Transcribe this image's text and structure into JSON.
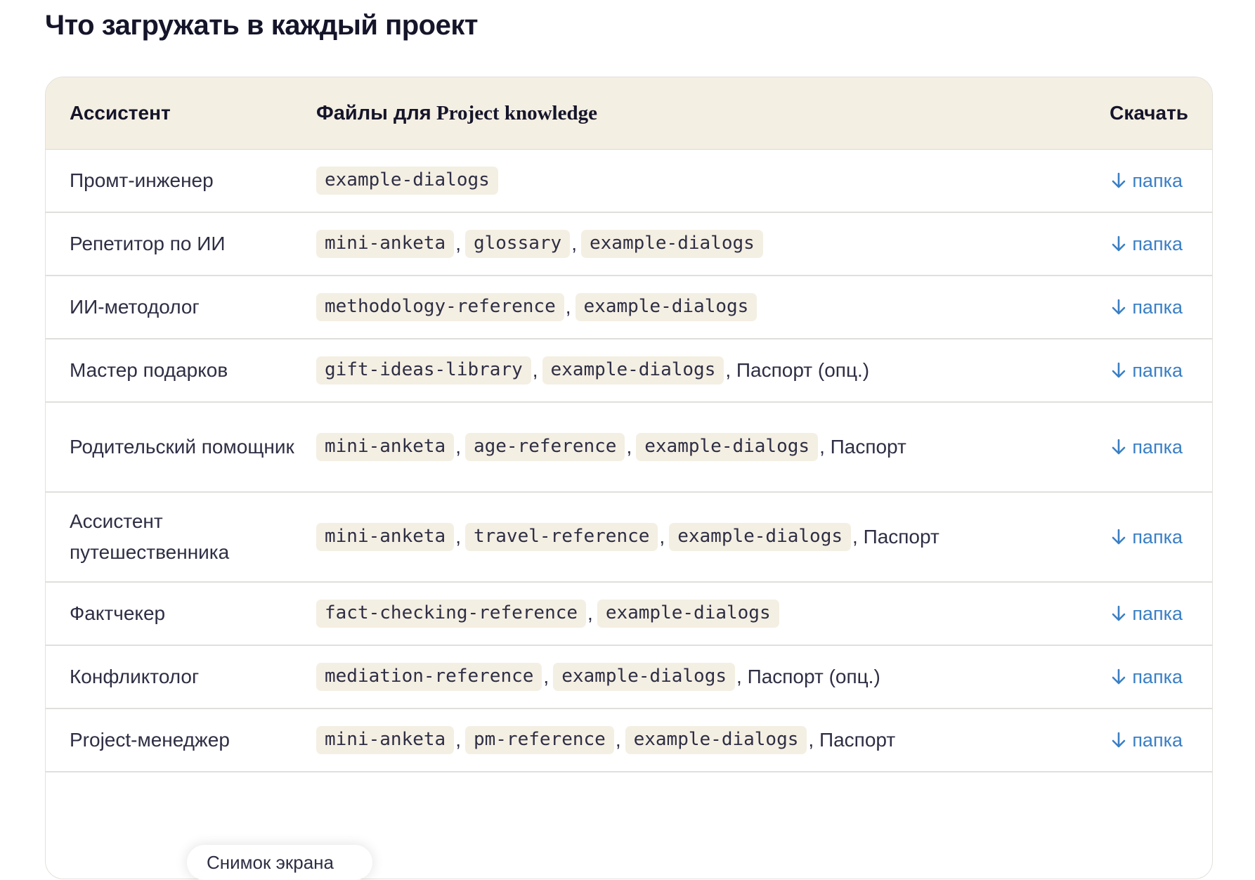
{
  "page": {
    "title": "Что загружать в каждый проект"
  },
  "table": {
    "headers": {
      "assistant": "Ассистент",
      "files_prefix": "Файлы для",
      "files_suffix": "Project knowledge",
      "download": "Скачать"
    },
    "download_icon": "arrow-down-icon",
    "link_color": "#3a7fc5",
    "chip_background": "#f4efe3",
    "rows": [
      {
        "assistant": "Промт-инженер",
        "files": [
          "example-dialogs"
        ],
        "suffix": "",
        "download": "папка",
        "tall": false
      },
      {
        "assistant": "Репетитор по ИИ",
        "files": [
          "mini-anketa",
          "glossary",
          "example-dialogs"
        ],
        "suffix": "",
        "download": "папка",
        "tall": false
      },
      {
        "assistant": "ИИ-методолог",
        "files": [
          "methodology-reference",
          "example-dialogs"
        ],
        "suffix": "",
        "download": "папка",
        "tall": false
      },
      {
        "assistant": "Мастер подарков",
        "files": [
          "gift-ideas-library",
          "example-dialogs"
        ],
        "suffix": ", Паспорт (опц.)",
        "download": "папка",
        "tall": false
      },
      {
        "assistant": "Родительский помощник",
        "files": [
          "mini-anketa",
          "age-reference",
          "example-dialogs"
        ],
        "suffix": ", Паспорт",
        "download": "папка",
        "tall": true
      },
      {
        "assistant": "Ассистент путешественника",
        "files": [
          "mini-anketa",
          "travel-reference",
          "example-dialogs"
        ],
        "suffix": ", Паспорт",
        "download": "папка",
        "tall": true
      },
      {
        "assistant": "Фактчекер",
        "files": [
          "fact-checking-reference",
          "example-dialogs"
        ],
        "suffix": "",
        "download": "папка",
        "tall": false
      },
      {
        "assistant": "Конфликтолог",
        "files": [
          "mediation-reference",
          "example-dialogs"
        ],
        "suffix": ", Паспорт (опц.)",
        "download": "папка",
        "tall": false
      },
      {
        "assistant": "Project-менеджер",
        "files": [
          "mini-anketa",
          "pm-reference",
          "example-dialogs"
        ],
        "suffix": ", Паспорт",
        "download": "папка",
        "tall": false
      }
    ]
  },
  "tooltip": {
    "text": "Снимок экрана"
  }
}
